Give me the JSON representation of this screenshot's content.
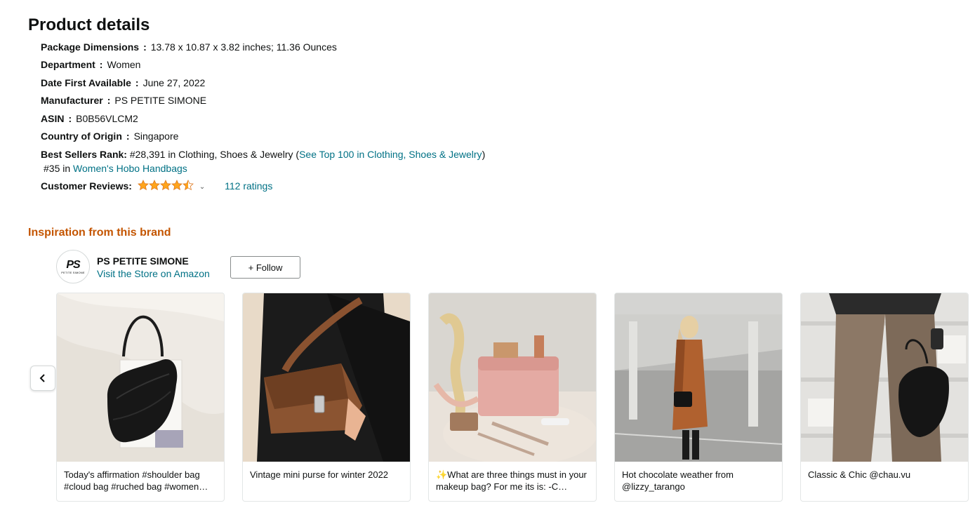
{
  "product_details": {
    "title": "Product details",
    "rows": [
      {
        "key": "Package Dimensions",
        "value": "13.78 x 10.87 x 3.82 inches; 11.36 Ounces"
      },
      {
        "key": "Department",
        "value": "Women"
      },
      {
        "key": "Date First Available",
        "value": "June 27, 2022"
      },
      {
        "key": "Manufacturer",
        "value": "PS PETITE SIMONE"
      },
      {
        "key": "ASIN",
        "value": "B0B56VLCM2"
      },
      {
        "key": "Country of Origin",
        "value": "Singapore"
      }
    ],
    "best_sellers": {
      "key": "Best Sellers Rank:",
      "rank1_text": "#28,391 in Clothing, Shoes & Jewelry (",
      "rank1_link": "See Top 100 in Clothing, Shoes & Jewelry",
      "rank1_close": ")",
      "rank2_text": "#35 in ",
      "rank2_link": "Women's Hobo Handbags"
    },
    "reviews": {
      "key": "Customer Reviews:",
      "rating": 4.5,
      "ratings_link": "112 ratings",
      "star_color": "#ffa41c"
    }
  },
  "inspiration": {
    "title": "Inspiration from this brand",
    "brand": {
      "logo_text": "PS",
      "logo_sub": "PETITE SIMONE",
      "name": "PS PETITE SIMONE",
      "store_link": "Visit the Store on Amazon",
      "follow_label": "+ Follow"
    },
    "prev_icon": "chevron-left-icon",
    "cards": [
      {
        "caption": "Today's affirmation #shoulder bag #cloud bag #ruched bag #women…"
      },
      {
        "caption": "Vintage mini purse for winter 2022"
      },
      {
        "caption": "✨What are three things must in your makeup bag? For me its is: -C…"
      },
      {
        "caption": "Hot chocolate weather from @lizzy_tarango"
      },
      {
        "caption": "Classic & Chic @chau.vu"
      }
    ]
  },
  "colors": {
    "link": "#007185",
    "heading_orange": "#c45500"
  }
}
